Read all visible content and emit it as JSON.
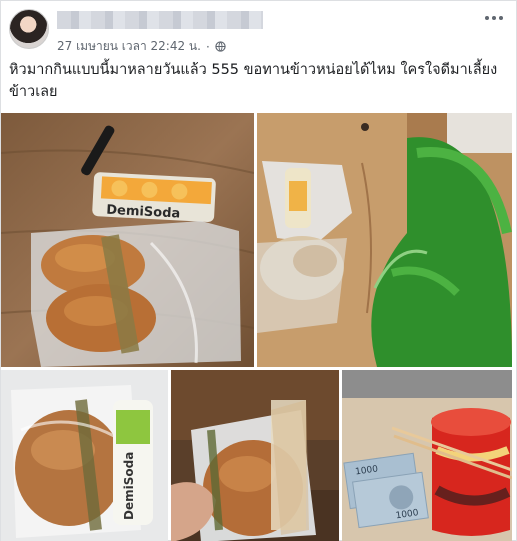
{
  "post": {
    "timestamp": "27 เมษายน เวลา 22:42 น.",
    "separator": "·",
    "text": "หิวมากกินแบบนี้มาหลายวันแล้ว 555 ขอทานข้าวหน่อยได้ไหม ใครใจดีมาเลี้ยงข้าวเลย",
    "privacy_icon": "globe-icon",
    "menu_icon": "more-options-icon"
  },
  "photos": {
    "p1_brand": "DemiSoda",
    "p3_brand": "DemiSoda",
    "p5_note_value": "1000",
    "p5_note_value_2": "1000"
  }
}
